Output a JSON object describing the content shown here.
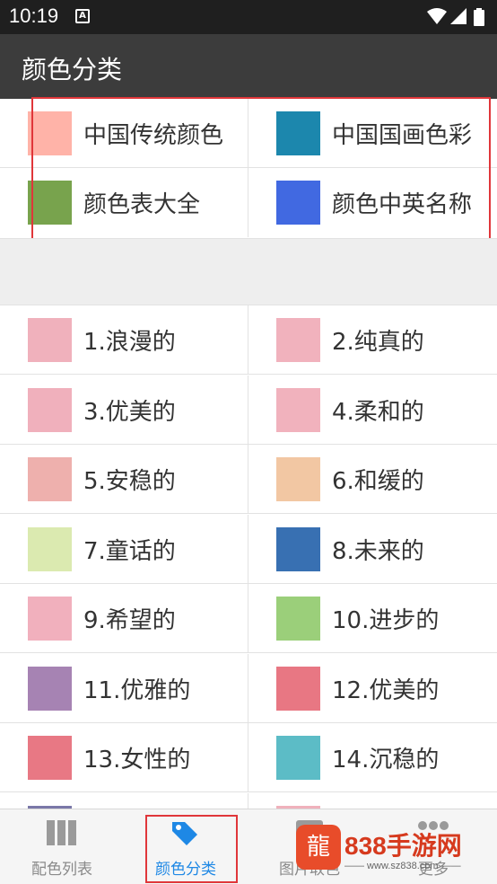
{
  "status_bar": {
    "time": "10:19",
    "notification_glyph": "A"
  },
  "app_bar": {
    "title": "颜色分类"
  },
  "featured": [
    {
      "label": "中国传统颜色",
      "color": "#ffb3a8"
    },
    {
      "label": "中国国画色彩",
      "color": "#1c87ad"
    },
    {
      "label": "颜色表大全",
      "color": "#78a34d"
    },
    {
      "label": "颜色中英名称",
      "color": "#4169e1"
    }
  ],
  "styles": [
    {
      "label": "1.浪漫的",
      "color": "#f0b1bc"
    },
    {
      "label": "2.纯真的",
      "color": "#f1b2bd"
    },
    {
      "label": "3.优美的",
      "color": "#f0b0bc"
    },
    {
      "label": "4.柔和的",
      "color": "#f1b2bd"
    },
    {
      "label": "5.安稳的",
      "color": "#eeb0ad"
    },
    {
      "label": "6.和缓的",
      "color": "#f2c7a3"
    },
    {
      "label": "7.童话的",
      "color": "#dbeab0"
    },
    {
      "label": "8.未来的",
      "color": "#3870b2"
    },
    {
      "label": "9.希望的",
      "color": "#f1b0bd"
    },
    {
      "label": "10.进步的",
      "color": "#9bcf7a"
    },
    {
      "label": "11.优雅的",
      "color": "#a683b3"
    },
    {
      "label": "12.优美的",
      "color": "#e87783"
    },
    {
      "label": "13.女性的",
      "color": "#e87884"
    },
    {
      "label": "14.沉稳的",
      "color": "#5cbcc6"
    },
    {
      "label": "",
      "color": "#7a78a8"
    },
    {
      "label": "",
      "color": "#f0b1bc"
    }
  ],
  "bottom_nav": [
    {
      "label": "配色列表",
      "icon": "grid-icon"
    },
    {
      "label": "颜色分类",
      "icon": "tag-icon"
    },
    {
      "label": "图片取色",
      "icon": "image-icon"
    },
    {
      "label": "更多",
      "icon": "more-icon"
    }
  ],
  "watermark": {
    "big": "838手游网",
    "small": "—— www.sz838.com ——"
  },
  "colors": {
    "accent": "#1e88e5",
    "highlight": "#e0363a",
    "appbar": "#3c3c3c",
    "statusbar": "#1f1f1f"
  }
}
